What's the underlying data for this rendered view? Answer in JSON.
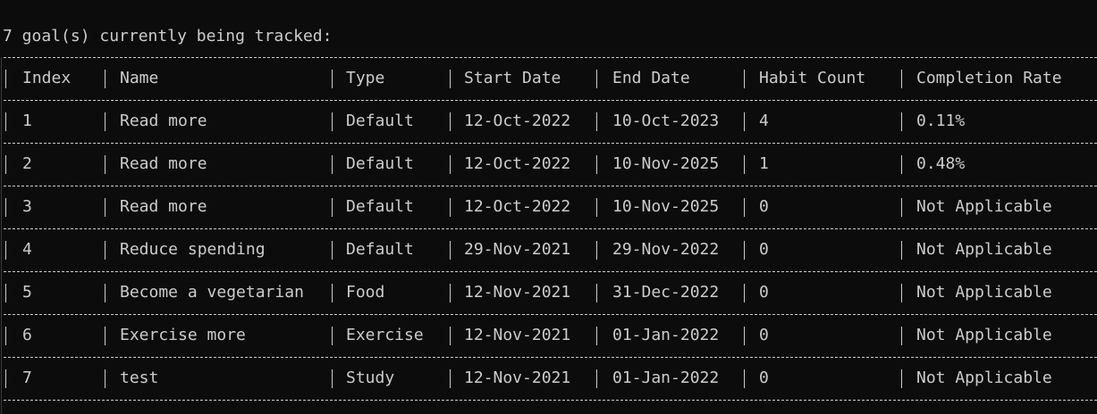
{
  "summary": "7 goal(s) currently being tracked:",
  "columns": [
    "Index",
    "Name",
    "Type",
    "Start Date",
    "End Date",
    "Habit Count",
    "Completion Rate"
  ],
  "rows": [
    [
      "1",
      "Read more",
      "Default",
      "12-Oct-2022",
      "10-Oct-2023",
      "4",
      "0.11%"
    ],
    [
      "2",
      "Read more",
      "Default",
      "12-Oct-2022",
      "10-Nov-2025",
      "1",
      "0.48%"
    ],
    [
      "3",
      "Read more",
      "Default",
      "12-Oct-2022",
      "10-Nov-2025",
      "0",
      "Not Applicable"
    ],
    [
      "4",
      "Reduce spending",
      "Default",
      "29-Nov-2021",
      "29-Nov-2022",
      "0",
      "Not Applicable"
    ],
    [
      "5",
      "Become a vegetarian",
      "Food",
      "12-Nov-2021",
      "31-Dec-2022",
      "0",
      "Not Applicable"
    ],
    [
      "6",
      "Exercise more",
      "Exercise",
      "12-Nov-2021",
      "01-Jan-2022",
      "0",
      "Not Applicable"
    ],
    [
      "7",
      "test",
      "Study",
      "12-Nov-2021",
      "01-Jan-2022",
      "0",
      "Not Applicable"
    ]
  ],
  "colors": {
    "background": "#0c0c0c",
    "foreground": "#cccccc"
  }
}
